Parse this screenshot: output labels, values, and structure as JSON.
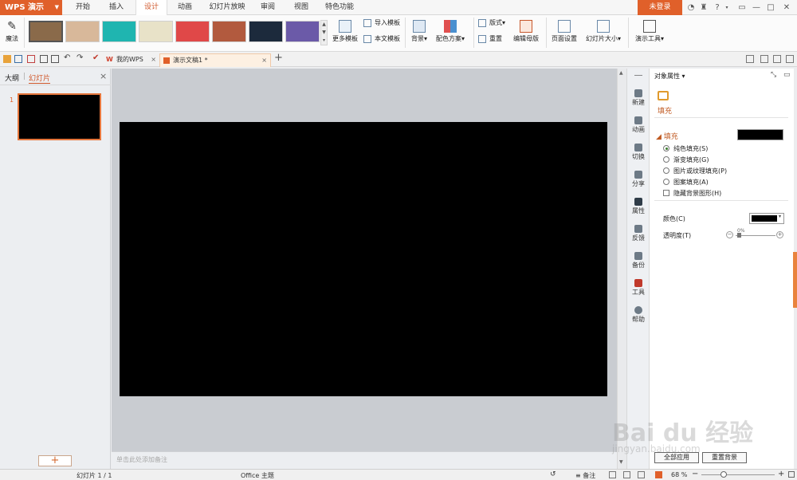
{
  "app": {
    "name": "WPS 演示"
  },
  "menu": {
    "tabs": [
      "开始",
      "插入",
      "设计",
      "动画",
      "幻灯片放映",
      "审阅",
      "视图",
      "特色功能"
    ],
    "active_tab": "设计",
    "login_label": "未登录",
    "help_label": "?"
  },
  "ribbon": {
    "magic_label": "魔法",
    "more_templates_label": "更多模板",
    "import_template_label": "导入模板",
    "this_doc_template_label": "本文模板",
    "background_label": "背景",
    "color_scheme_label": "配色方案",
    "layout_label": "版式",
    "reset_label": "重置",
    "edit_master_label": "编辑母版",
    "page_setup_label": "页面设置",
    "slide_size_label": "幻灯片大小",
    "present_tools_label": "演示工具",
    "theme_colors": [
      "#8a6a4a",
      "#d8b89a",
      "#1fb5b0",
      "#e8e2c8",
      "#e04848",
      "#b25a3e",
      "#1c2a3c",
      "#6b5aa8"
    ]
  },
  "doc_tabs": [
    {
      "label": "我的WPS"
    },
    {
      "label": "演示文稿1 *"
    }
  ],
  "left_panel": {
    "tab_outline": "大纲",
    "tab_slides": "幻灯片",
    "slide_number": "1",
    "add_label": "+"
  },
  "notes_placeholder": "单击此处添加备注",
  "side_strip": {
    "items": [
      "新建",
      "动画",
      "切换",
      "分享",
      "属性",
      "反馈",
      "备份",
      "工具",
      "帮助"
    ]
  },
  "props": {
    "title": "对象属性",
    "tab_fill": "填充",
    "section_fill": "填充",
    "fill_color": "#000000",
    "options": [
      {
        "label": "纯色填充(S)",
        "selected": true
      },
      {
        "label": "渐变填充(G)",
        "selected": false
      },
      {
        "label": "图片或纹理填充(P)",
        "selected": false
      },
      {
        "label": "图案填充(A)",
        "selected": false
      }
    ],
    "hide_bg_label": "隐藏背景图形(H)",
    "color_label": "颜色(C)",
    "transparency_label": "透明度(T)",
    "transparency_value": "0%",
    "apply_all_label": "全部应用",
    "reset_bg_label": "重置背景"
  },
  "status": {
    "slide_info": "幻灯片 1 / 1",
    "theme": "Office 主题",
    "notes_label": "备注",
    "zoom": "68 %"
  },
  "watermark": {
    "text": "Bai du 经验",
    "url": "jingyan.baidu.com"
  }
}
